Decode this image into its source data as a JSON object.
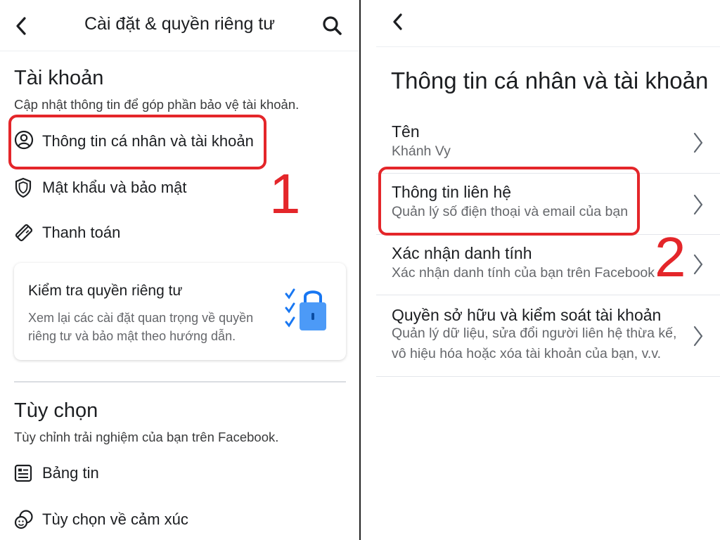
{
  "left": {
    "header": {
      "title": "Cài đặt & quyền riêng tư"
    },
    "account": {
      "title": "Tài khoản",
      "subtitle": "Cập nhật thông tin để góp phần bảo vệ tài khoản.",
      "items": [
        {
          "label": "Thông tin cá nhân và tài khoản",
          "icon": "person-circle-icon"
        },
        {
          "label": "Mật khẩu và bảo mật",
          "icon": "shield-icon"
        },
        {
          "label": "Thanh toán",
          "icon": "tag-icon"
        }
      ]
    },
    "privacy_card": {
      "title": "Kiểm tra quyền riêng tư",
      "desc_line1": "Xem lại các cài đặt quan trọng về quyền",
      "desc_line2": "riêng tư và bảo mật theo hướng dẫn."
    },
    "preferences": {
      "title": "Tùy chọn",
      "subtitle": "Tùy chỉnh trải nghiệm của bạn trên Facebook.",
      "items": [
        {
          "label": "Bảng tin",
          "icon": "news-feed-icon"
        },
        {
          "label": "Tùy chọn về cảm xúc",
          "icon": "reactions-icon"
        }
      ]
    },
    "annotation_number": "1"
  },
  "right": {
    "page_title": "Thông tin cá nhân và tài khoản",
    "items": [
      {
        "title": "Tên",
        "sub1": "Khánh Vy"
      },
      {
        "title": "Thông tin liên hệ",
        "sub1": "Quản lý số điện thoại và email của bạn"
      },
      {
        "title": "Xác nhận danh tính",
        "sub1": "Xác nhận danh tính của bạn trên Facebook"
      },
      {
        "title": "Quyền sở hữu và kiểm soát tài khoản",
        "sub1": "Quản lý dữ liệu, sửa đổi người liên hệ thừa kế,",
        "sub2": "vô hiệu hóa hoặc xóa tài khoản của bạn, v.v."
      }
    ],
    "annotation_number": "2"
  },
  "colors": {
    "highlight": "#e4262a",
    "accent_blue": "#1877f2",
    "divider": "#e4e6eb"
  }
}
